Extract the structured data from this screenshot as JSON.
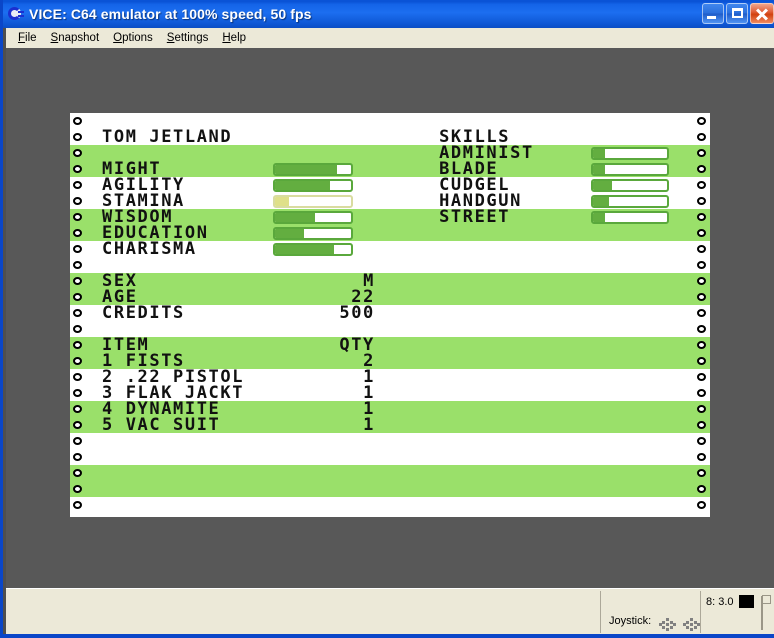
{
  "window": {
    "title": "VICE: C64 emulator at 100% speed, 50 fps",
    "icon": "commodore-logo-icon",
    "controls": {
      "minimize": "Minimize",
      "maximize": "Maximize",
      "close": "Close"
    }
  },
  "menubar": {
    "items": [
      {
        "label": "File",
        "accel": "F",
        "rest": "ile"
      },
      {
        "label": "Snapshot",
        "accel": "S",
        "rest": "napshot"
      },
      {
        "label": "Options",
        "accel": "O",
        "rest": "ptions"
      },
      {
        "label": "Settings",
        "accel": "S",
        "rest": "ettings"
      },
      {
        "label": "Help",
        "accel": "H",
        "rest": "elp"
      }
    ]
  },
  "screen": {
    "character_name": "TOM JETLAND",
    "skills_header": "SKILLS",
    "attributes": [
      {
        "name": "MIGHT",
        "fill": 82,
        "color": "green"
      },
      {
        "name": "AGILITY",
        "fill": 72,
        "color": "green"
      },
      {
        "name": "STAMINA",
        "fill": 18,
        "color": "yellow"
      },
      {
        "name": "WISDOM",
        "fill": 52,
        "color": "green"
      },
      {
        "name": "EDUCATION",
        "fill": 38,
        "color": "green"
      },
      {
        "name": "CHARISMA",
        "fill": 78,
        "color": "green"
      }
    ],
    "skills": [
      {
        "name": "ADMINIST",
        "fill": 16,
        "color": "green"
      },
      {
        "name": "BLADE",
        "fill": 16,
        "color": "green"
      },
      {
        "name": "CUDGEL",
        "fill": 25,
        "color": "green"
      },
      {
        "name": "HANDGUN",
        "fill": 22,
        "color": "green"
      },
      {
        "name": "STREET",
        "fill": 16,
        "color": "green"
      }
    ],
    "vitals": [
      {
        "label": "SEX",
        "value": "M"
      },
      {
        "label": "AGE",
        "value": "22"
      },
      {
        "label": "CREDITS",
        "value": "500"
      }
    ],
    "inventory_header": {
      "item": "ITEM",
      "qty": "QTY"
    },
    "inventory": [
      {
        "index": "1",
        "name": "FISTS",
        "qty": "2"
      },
      {
        "index": "2",
        "name": ".22 PISTOL",
        "qty": "1"
      },
      {
        "index": "3",
        "name": "FLAK JACKT",
        "qty": "1"
      },
      {
        "index": "4",
        "name": "DYNAMITE",
        "qty": "1"
      },
      {
        "index": "5",
        "name": "VAC SUIT",
        "qty": "1"
      }
    ]
  },
  "statusbar": {
    "joystick_label": "Joystick:",
    "drive_text": "8: 3.0",
    "drive_led_color": "#000000"
  },
  "colors": {
    "titlebar_blue": "#1464e8",
    "screen_green": "#9ae06a",
    "bar_green": "#63ae40",
    "bar_border": "#5aa83c",
    "bar_yellow": "#dfe08a",
    "chrome": "#ece9d8",
    "border_grey": "#585858"
  }
}
